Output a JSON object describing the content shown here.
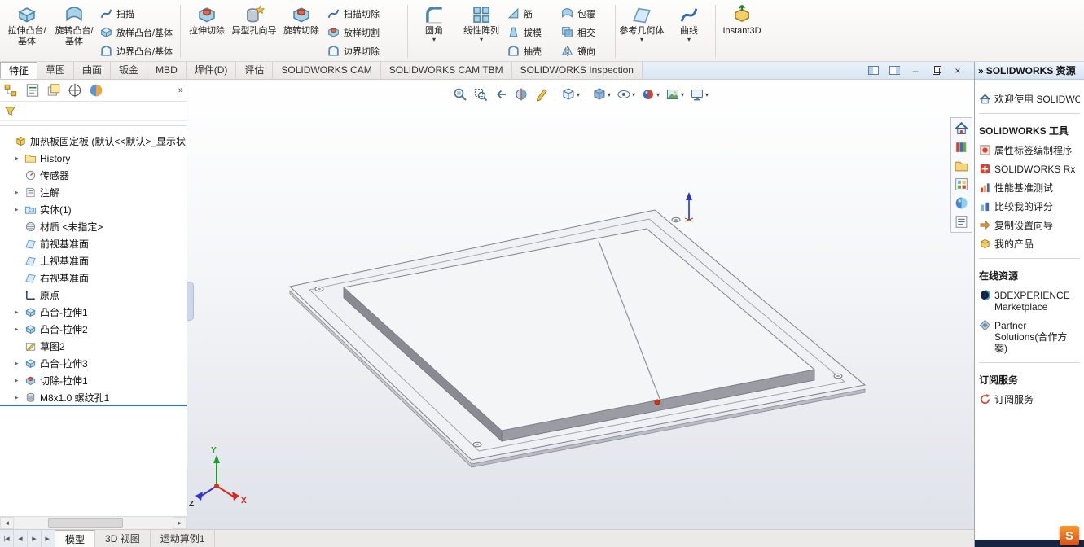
{
  "icons": {
    "caret": "▾",
    "expander": "▸",
    "chevrons": "»",
    "minimize": "–",
    "close": "×",
    "scroll_left": "◄",
    "scroll_right": "►"
  },
  "tab_nav": {
    "first": "|◀",
    "prev": "◀",
    "next": "▶",
    "last": "▶|"
  },
  "ribbon": {
    "extrude_boss": "拉伸凸台/基体",
    "revolve_boss": "旋转凸台/基体",
    "swept_boss": "扫描",
    "loft_boss": "放样凸台/基体",
    "boundary_boss": "边界凸台/基体",
    "extrude_cut": "拉伸切除",
    "hole_wizard": "异型孔向导",
    "revolve_cut": "旋转切除",
    "swept_cut": "扫描切除",
    "loft_cut": "放样切割",
    "boundary_cut": "边界切除",
    "fillet": "圆角",
    "linear_pattern": "线性阵列",
    "rib": "筋",
    "draft": "拔模",
    "shell": "抽壳",
    "wrap": "包覆",
    "intersect": "相交",
    "mirror": "镜向",
    "ref_geometry": "参考几何体",
    "curves": "曲线",
    "instant3d": "Instant3D"
  },
  "ribbon_tabs": {
    "items": [
      "特征",
      "草图",
      "曲面",
      "钣金",
      "MBD",
      "焊件(D)",
      "评估",
      "SOLIDWORKS CAM",
      "SOLIDWORKS CAM TBM",
      "SOLIDWORKS Inspection"
    ],
    "active": "特征"
  },
  "feature_tree": {
    "part_name": "加热板固定板 (默认<<默认>_显示状",
    "items": [
      {
        "label": "History"
      },
      {
        "label": "传感器"
      },
      {
        "label": "注解"
      },
      {
        "label": "实体(1)"
      },
      {
        "label": "材质 <未指定>"
      },
      {
        "label": "前视基准面"
      },
      {
        "label": "上视基准面"
      },
      {
        "label": "右视基准面"
      },
      {
        "label": "原点"
      },
      {
        "label": "凸台-拉伸1"
      },
      {
        "label": "凸台-拉伸2"
      },
      {
        "label": "草图2"
      },
      {
        "label": "凸台-拉伸3"
      },
      {
        "label": "切除-拉伸1"
      },
      {
        "label": "M8x1.0 螺纹孔1"
      }
    ]
  },
  "viewport": {
    "triad": {
      "x": "X",
      "y": "Y",
      "z": "Z"
    }
  },
  "task_pane": {
    "header": "SOLIDWORKS 资源",
    "welcome": "欢迎使用 SOLIDWORKS",
    "tools_section": "SOLIDWORKS 工具",
    "tools": [
      "属性标签编制程序",
      "SOLIDWORKS Rx",
      "性能基准测试",
      "比较我的评分",
      "复制设置向导",
      "我的产品"
    ],
    "online_section": "在线资源",
    "online": [
      "3DEXPERIENCE Marketplace",
      "Partner Solutions(合作方案)"
    ],
    "subscription_section": "订阅服务",
    "subscription": [
      "订阅服务"
    ],
    "logo": "S"
  },
  "bottom_tabs": {
    "items": [
      "模型",
      "3D 视图",
      "运动算例1"
    ],
    "active": "模型"
  }
}
